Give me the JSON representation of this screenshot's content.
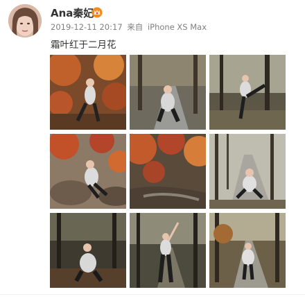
{
  "post": {
    "username": "Ana秦妃",
    "badge_icon": "vip-crown-icon",
    "timestamp": "2019-12-11 20:17",
    "source_prefix": "来自",
    "source_device": "iPhone XS Max",
    "text": "霜叶红于二月花"
  },
  "photos": [
    {
      "icon": "photo-1",
      "scene": "red autumn leaves, pose leaning"
    },
    {
      "icon": "photo-2",
      "scene": "road with trees, crouching pose"
    },
    {
      "icon": "photo-3",
      "scene": "forest, leg raised pose"
    },
    {
      "icon": "photo-4",
      "scene": "rocks and red leaves, sitting"
    },
    {
      "icon": "photo-5",
      "scene": "red foliage and stream"
    },
    {
      "icon": "photo-6",
      "scene": "bare trees, sitting on road"
    },
    {
      "icon": "photo-7",
      "scene": "dark woods, kneeling looking up"
    },
    {
      "icon": "photo-8",
      "scene": "path in woods, arm raised"
    },
    {
      "icon": "photo-9",
      "scene": "tree-lined road, standing"
    }
  ]
}
